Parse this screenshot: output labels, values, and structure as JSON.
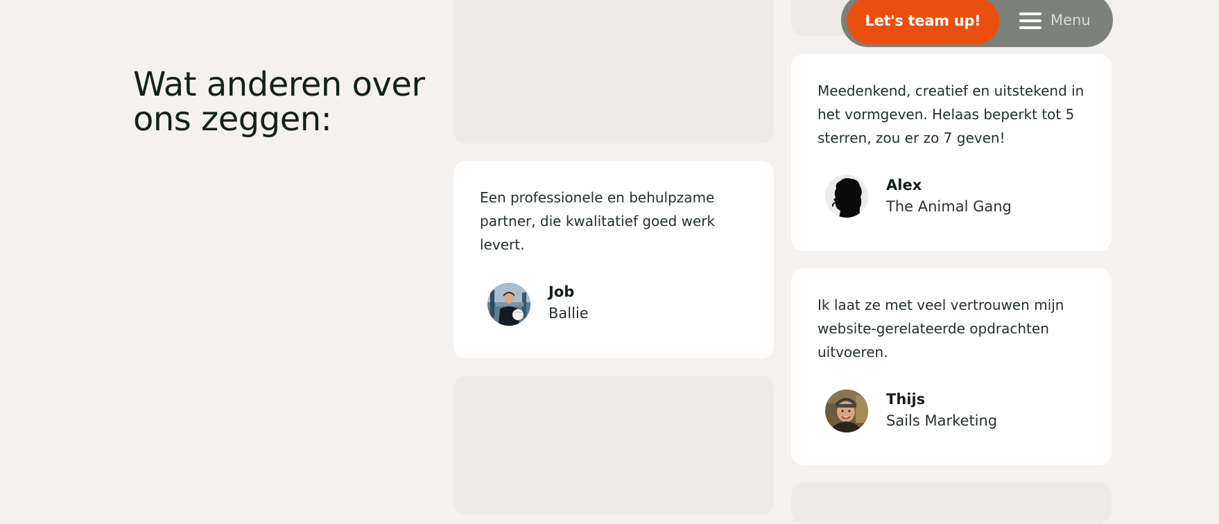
{
  "section": {
    "heading": "Wat anderen over ons zeggen:"
  },
  "nav": {
    "cta_label": "Let's team up!",
    "menu_label": "Menu",
    "menu_icon": "hamburger-menu-icon",
    "cta_color": "#e9500f",
    "pill_color": "#7d817c"
  },
  "testimonials": [
    {
      "quote": "Een professionele en behulpzame partner, die kwalitatief goed werk levert.",
      "name": "Job",
      "company": "Ballie",
      "avatar": "person-photo-avatar"
    },
    {
      "quote": "Meedenkend, creatief en uitstekend in het vormgeven. Helaas beperkt tot 5 sterren, zou er zo 7 geven!",
      "name": "Alex",
      "company": "The Animal Gang",
      "avatar": "silhouette-avatar"
    },
    {
      "quote": "Ik laat ze met veel vertrouwen mijn website-gerelateerde opdrachten uitvoeren.",
      "name": "Thijs",
      "company": "Sails Marketing",
      "avatar": "person-photo-avatar"
    }
  ]
}
